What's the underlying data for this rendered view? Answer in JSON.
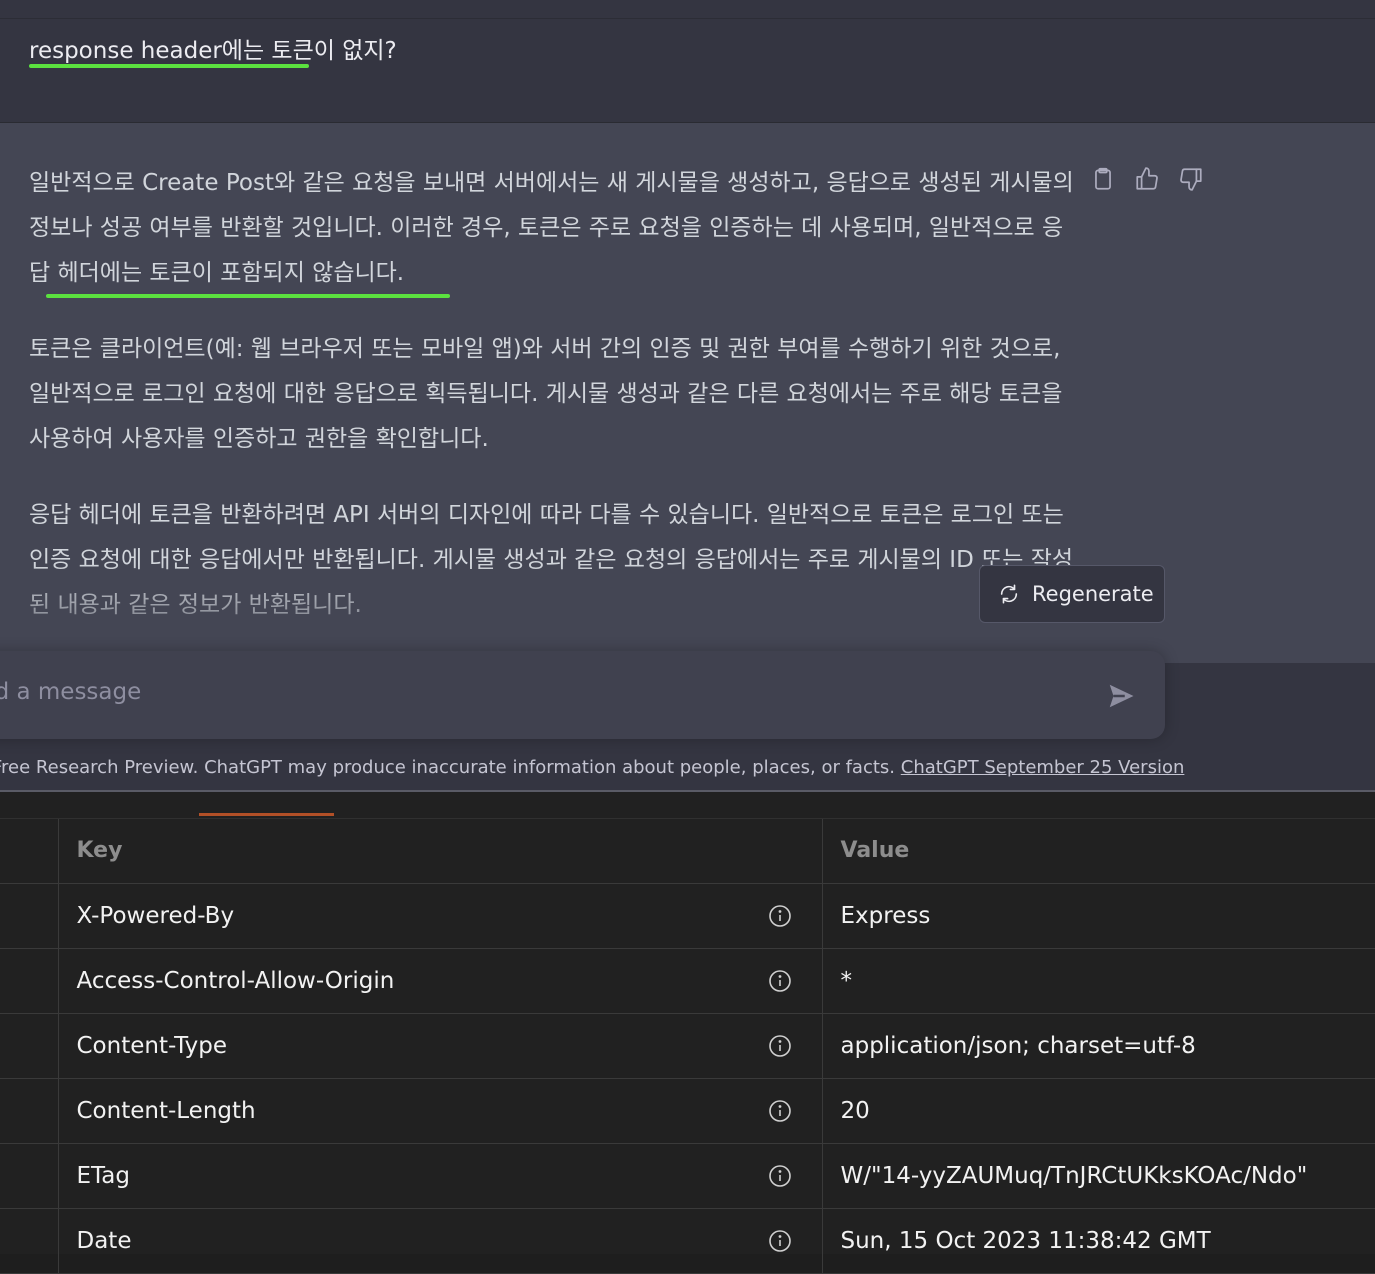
{
  "chat": {
    "user_message": "response header에는 토큰이 없지?",
    "assistant_paragraphs": [
      "일반적으로 Create Post와 같은 요청을 보내면 서버에서는 새 게시물을 생성하고, 응답으로 생성된 게시물의 정보나 성공 여부를 반환할 것입니다. 이러한 경우, 토큰은 주로 요청을 인증하는 데 사용되며, 일반적으로 응답 헤더에는 토큰이 포함되지 않습니다.",
      "토큰은 클라이언트(예: 웹 브라우저 또는 모바일 앱)와 서버 간의 인증 및 권한 부여를 수행하기 위한 것으로, 일반적으로 로그인 요청에 대한 응답으로 획득됩니다. 게시물 생성과 같은 다른 요청에서는 주로 해당 토큰을 사용하여 사용자를 인증하고 권한을 확인합니다.",
      "응답 헤더에 토큰을 반환하려면 API 서버의 디자인에 따라 다를 수 있습니다. 일반적으로 토큰은 로그인 또는 인증 요청에 대한 응답에서만 반환됩니다. 게시물 생성과 같은 요청의 응답에서는 주로 게시물의 ID 또는 작성된 내용과 같은 정보가 반환됩니다."
    ],
    "icons": [
      "clipboard-icon",
      "thumbs-up-icon",
      "thumbs-down-icon"
    ],
    "regenerate_label": "Regenerate",
    "input_placeholder": "nd a message",
    "footer_text": "Free Research Preview. ChatGPT may produce inaccurate information about people, places, or facts.",
    "footer_link": "ChatGPT September 25 Version"
  },
  "headers_table": {
    "columns": [
      "Key",
      "Value"
    ],
    "rows": [
      {
        "key": "X-Powered-By",
        "value": "Express"
      },
      {
        "key": "Access-Control-Allow-Origin",
        "value": "*"
      },
      {
        "key": "Content-Type",
        "value": "application/json; charset=utf-8"
      },
      {
        "key": "Content-Length",
        "value": "20"
      },
      {
        "key": "ETag",
        "value": "W/\"14-yyZAUMuq/TnJRCtUKksKOAc/Ndo\""
      },
      {
        "key": "Date",
        "value": "Sun, 15 Oct 2023 11:38:42 GMT"
      }
    ]
  },
  "colors": {
    "chat_bg": "#343541",
    "assistant_bg": "#444654",
    "highlight_underline": "#5be13f",
    "panel_bg": "#212121",
    "active_tab": "#b25027"
  }
}
